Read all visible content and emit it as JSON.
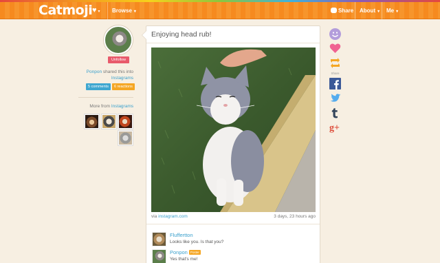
{
  "header": {
    "logo": "Catmoji",
    "heart_caret": "▾",
    "browse_label": "Browse",
    "share_label": "Share",
    "about_label": "About",
    "me_label": "Me",
    "caret": "▾"
  },
  "profile": {
    "unfollow_label": "Unfollow",
    "user_name": "Ponpon",
    "shared_text": "shared this into",
    "collection_name": "Instagrams",
    "comments_badge": "5 comments",
    "reactions_badge": "6 reactions",
    "more_from_text": "More from",
    "more_from_collection": "Instagrams"
  },
  "post": {
    "title": "Enjoying head rub!",
    "via_text": "via",
    "source_link": "instagram.com",
    "timestamp": "3 days, 23 hours ago"
  },
  "comments": [
    {
      "author": "Fluffertton",
      "text": "Looks like you. Is that you?",
      "tag": ""
    },
    {
      "author": "Ponpon",
      "text": "Yes that's me!",
      "tag": "Poster"
    }
  ],
  "social": {
    "share_caption": "Share"
  },
  "colors": {
    "brand_orange": "#f68a1f",
    "link_blue": "#3aa0cc",
    "unfollow_pink": "#e85a6b",
    "reaction_orange": "#f5a623"
  }
}
